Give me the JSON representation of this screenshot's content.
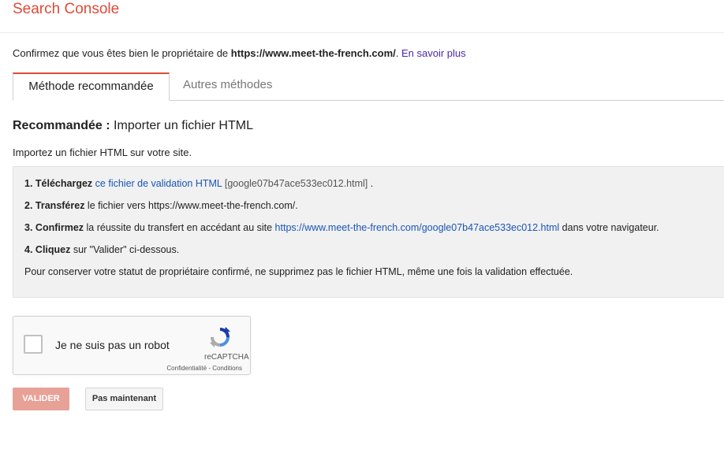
{
  "header": {
    "title": "Search Console"
  },
  "intro": {
    "prefix": "Confirmez que vous êtes bien le propriétaire de ",
    "site": "https://www.meet-the-french.com/",
    "suffix": ". ",
    "learn_more": "En savoir plus"
  },
  "tabs": [
    {
      "label": "Méthode recommandée",
      "active": true
    },
    {
      "label": "Autres méthodes",
      "active": false
    }
  ],
  "section": {
    "title_bold": "Recommandée :",
    "title_rest": " Importer un fichier HTML",
    "subtitle": "Importez un fichier HTML sur votre site."
  },
  "steps": [
    {
      "num": "1.",
      "verb": "Téléchargez",
      "link": "ce fichier de validation HTML",
      "file": "[google07b47ace533ec012.html]",
      "end": " ."
    },
    {
      "num": "2.",
      "verb": "Transférez",
      "text": " le fichier vers https://www.meet-the-french.com/."
    },
    {
      "num": "3.",
      "verb": "Confirmez",
      "text": " la réussite du transfert en accédant au site ",
      "link": "https://www.meet-the-french.com/google07b47ace533ec012.html",
      "end": " dans votre navigateur."
    },
    {
      "num": "4.",
      "verb": "Cliquez",
      "text": " sur \"Valider\" ci-dessous."
    }
  ],
  "note": "Pour conserver votre statut de propriétaire confirmé, ne supprimez pas le fichier HTML, même une fois la validation effectuée.",
  "captcha": {
    "label": "Je ne suis pas un robot",
    "brand": "reCAPTCHA",
    "terms": "Confidentialité - Conditions",
    "checked": false
  },
  "buttons": {
    "validate": "VALIDER",
    "later": "Pas maintenant"
  },
  "colors": {
    "brand": "#dd4b39",
    "link": "#1a55b5",
    "validate_disabled": "#e8a196"
  }
}
